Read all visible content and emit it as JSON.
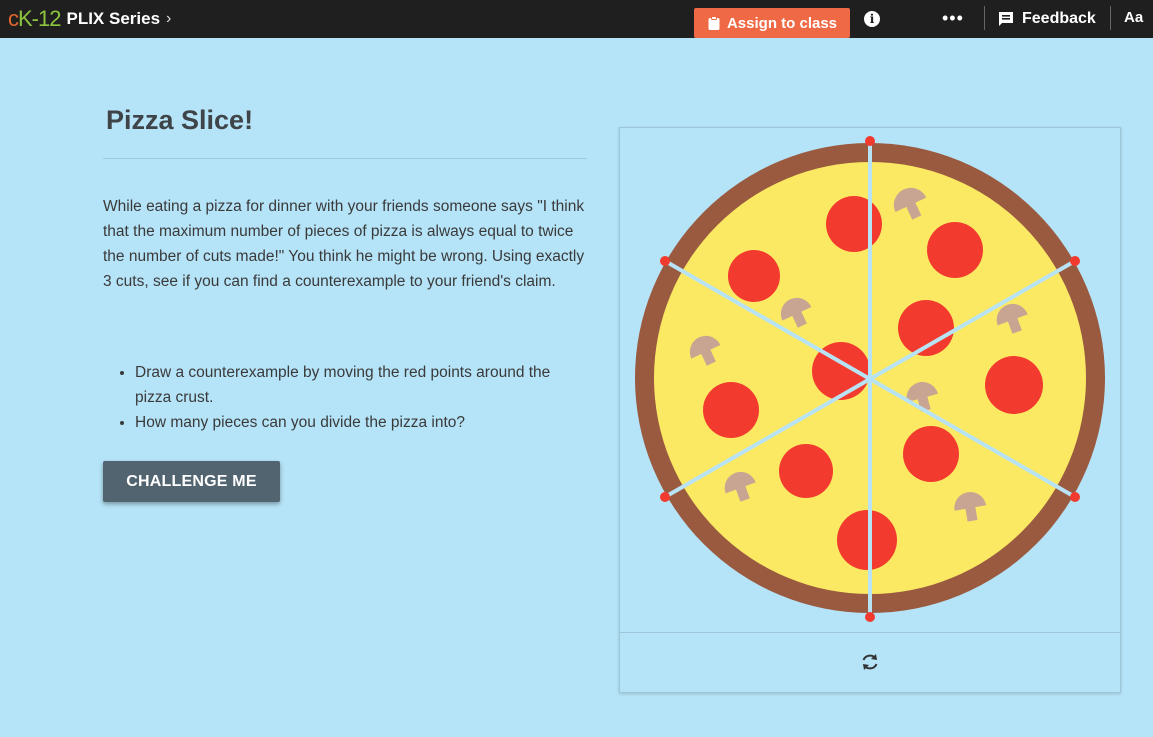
{
  "topbar": {
    "logo_c": "c",
    "logo_rest": "K-12",
    "series": "PLIX Series",
    "series_chevron": "›",
    "assign_label": "Assign to class",
    "info_glyph": "i",
    "more_glyph": "•••",
    "feedback_label": "Feedback",
    "font_toggle": "Aa"
  },
  "main": {
    "title": "Pizza Slice!",
    "description": "While eating a pizza for dinner with your friends someone says \"I think that the maximum number of pieces of pizza is always equal to twice the number of cuts made!\" You think he might be wrong. Using exactly 3 cuts, see if you can find a counterexample to your friend's claim.",
    "instructions": [
      "Draw a counterexample by moving the red points around the pizza crust.",
      "How many pieces can you divide the pizza into?"
    ],
    "challenge_label": "CHALLENGE ME"
  },
  "icons": {
    "assign": "clipboard-icon",
    "info": "info-icon",
    "more": "more-horizontal-icon",
    "feedback": "feedback-icon",
    "refresh": "refresh-icon"
  },
  "colors": {
    "background": "#b5e3f7",
    "topbar": "#1f1f1f",
    "assign_button": "#ef6a44",
    "challenge_button": "#516470",
    "crust": "#9a5a40",
    "cheese": "#fbe963",
    "pepperoni": "#f33a2f",
    "mushroom": "#c8a592",
    "cut_line": "#b8e3f4",
    "handle": "#f33a2f"
  }
}
